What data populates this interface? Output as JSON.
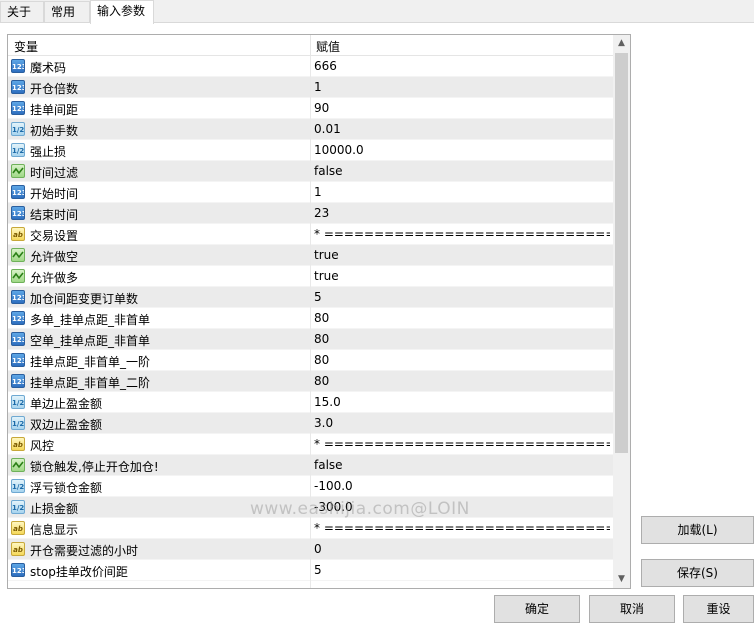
{
  "tabs": [
    {
      "label": "关于"
    },
    {
      "label": "常用"
    },
    {
      "label": "输入参数"
    }
  ],
  "grid": {
    "col_variable": "变量",
    "col_value": "赋值",
    "rows": [
      {
        "icon": "123",
        "type": "int",
        "name": "魔术码",
        "value": "666"
      },
      {
        "icon": "123",
        "type": "int",
        "name": "开仓倍数",
        "value": "1"
      },
      {
        "icon": "123",
        "type": "int",
        "name": "挂单间距",
        "value": "90"
      },
      {
        "icon": "1/2",
        "type": "dbl",
        "name": "初始手数",
        "value": "0.01"
      },
      {
        "icon": "1/2",
        "type": "dbl",
        "name": "强止损",
        "value": "10000.0"
      },
      {
        "icon": "bool",
        "type": "bool",
        "name": "时间过滤",
        "value": "false"
      },
      {
        "icon": "123",
        "type": "int",
        "name": "开始时间",
        "value": "1"
      },
      {
        "icon": "123",
        "type": "int",
        "name": "结束时间",
        "value": "23"
      },
      {
        "icon": "ab",
        "type": "str",
        "name": "交易设置",
        "value": "* ==============================..."
      },
      {
        "icon": "bool",
        "type": "bool",
        "name": "允许做空",
        "value": "true"
      },
      {
        "icon": "bool",
        "type": "bool",
        "name": "允许做多",
        "value": "true"
      },
      {
        "icon": "123",
        "type": "int",
        "name": "加仓间距变更订单数",
        "value": "5"
      },
      {
        "icon": "123",
        "type": "int",
        "name": "多单_挂单点距_非首单",
        "value": "80"
      },
      {
        "icon": "123",
        "type": "int",
        "name": "空单_挂单点距_非首单",
        "value": "80"
      },
      {
        "icon": "123",
        "type": "int",
        "name": "挂单点距_非首单_一阶",
        "value": "80"
      },
      {
        "icon": "123",
        "type": "int",
        "name": "挂单点距_非首单_二阶",
        "value": "80"
      },
      {
        "icon": "1/2",
        "type": "dbl",
        "name": "单边止盈金额",
        "value": "15.0"
      },
      {
        "icon": "1/2",
        "type": "dbl",
        "name": "双边止盈金额",
        "value": "3.0"
      },
      {
        "icon": "ab",
        "type": "str",
        "name": "风控",
        "value": "* ==============================..."
      },
      {
        "icon": "bool",
        "type": "bool",
        "name": "锁仓触发,停止开仓加仓!",
        "value": "false"
      },
      {
        "icon": "1/2",
        "type": "dbl",
        "name": "浮亏锁仓金额",
        "value": "-100.0"
      },
      {
        "icon": "1/2",
        "type": "dbl",
        "name": "止损金额",
        "value": "-300.0"
      },
      {
        "icon": "ab",
        "type": "str",
        "name": "信息显示",
        "value": "* ==============================..."
      },
      {
        "icon": "ab",
        "type": "str",
        "name": "开仓需要过滤的小时",
        "value": "0"
      },
      {
        "icon": "123",
        "type": "int",
        "name": "stop挂单改价间距",
        "value": "5"
      }
    ]
  },
  "buttons": {
    "load": "加载(L)",
    "save": "保存(S)",
    "ok": "确定",
    "cancel": "取消",
    "reset": "重设"
  },
  "watermark": "www.eashijia.com@LOIN"
}
